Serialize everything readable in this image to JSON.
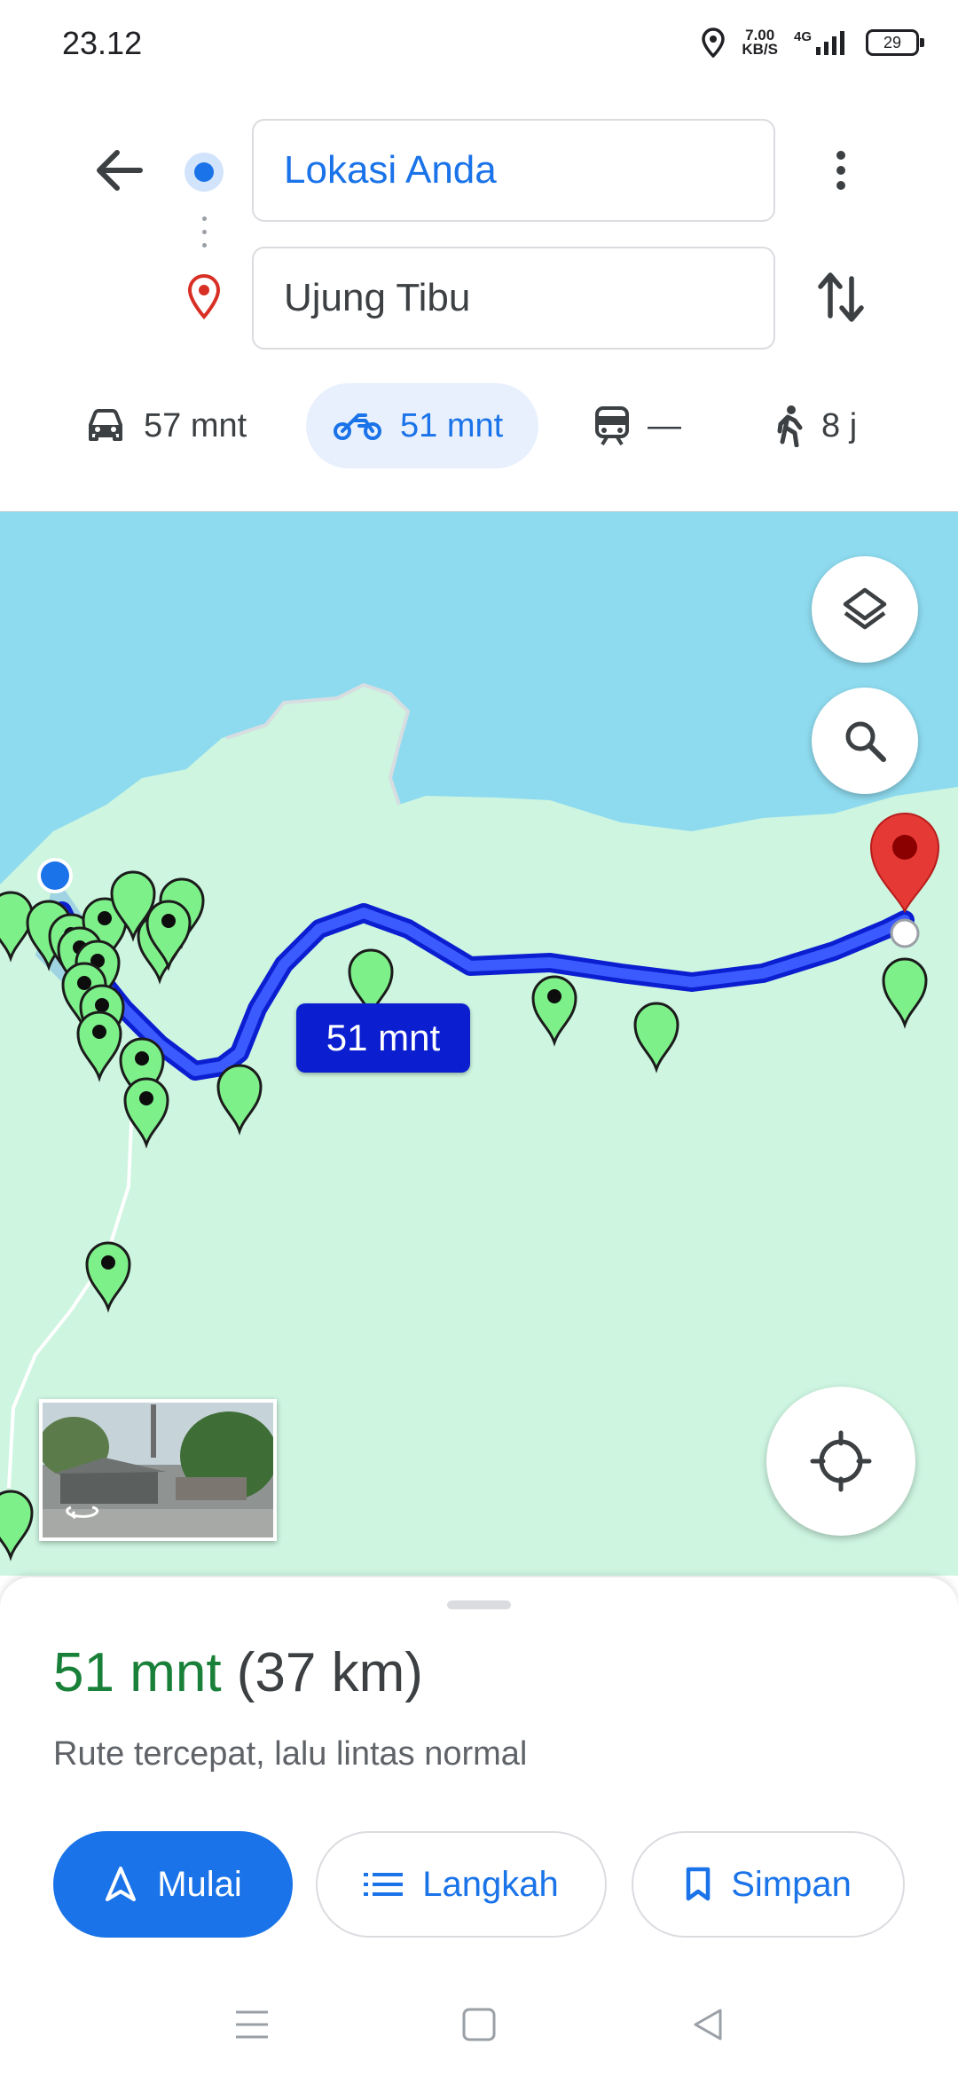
{
  "status_bar": {
    "time": "23.12",
    "net_speed_value": "7.00",
    "net_speed_unit": "KB/S",
    "network": "4G",
    "battery": "29"
  },
  "route": {
    "origin": "Lokasi Anda",
    "destination": "Ujung Tibu"
  },
  "modes": [
    {
      "name": "car",
      "icon": "car-icon",
      "label": "57 mnt"
    },
    {
      "name": "motorcycle",
      "icon": "motorcycle-icon",
      "label": "51 mnt",
      "active": true
    },
    {
      "name": "transit",
      "icon": "train-icon",
      "label": "—"
    },
    {
      "name": "walk",
      "icon": "walking-icon",
      "label": "8 j"
    }
  ],
  "map": {
    "route_label": "51 mnt",
    "colors": {
      "water": "#8edbef",
      "land": "#cdf5e0",
      "route": "#1a3ee8",
      "marker": "#7ef08a",
      "destination": "#e53935"
    }
  },
  "sheet": {
    "duration": "51 mnt",
    "distance": "(37 km)",
    "description": "Rute tercepat, lalu lintas normal",
    "start_label": "Mulai",
    "steps_label": "Langkah",
    "save_label": "Simpan"
  },
  "colors": {
    "accent": "#1a73e8",
    "duration_green": "#188038"
  }
}
